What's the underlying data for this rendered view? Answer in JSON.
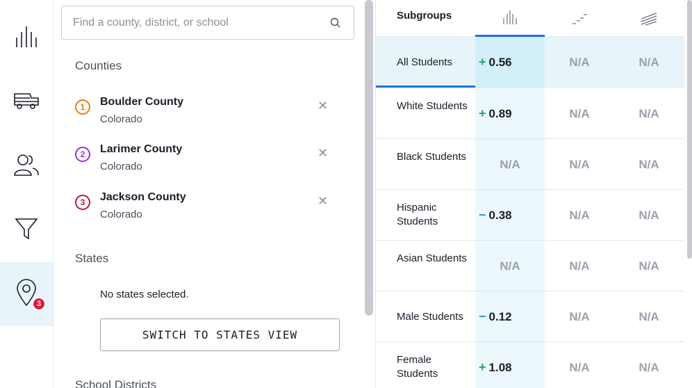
{
  "rail": {
    "items": [
      {
        "icon": "bar-chart-icon"
      },
      {
        "icon": "school-bus-icon"
      },
      {
        "icon": "people-icon"
      },
      {
        "icon": "filter-icon"
      },
      {
        "icon": "location-pin-icon",
        "badge": "3"
      }
    ]
  },
  "search": {
    "placeholder": "Find a county, district, or school"
  },
  "counties": {
    "title": "Counties",
    "items": [
      {
        "num": "1",
        "name": "Boulder County",
        "state": "Colorado",
        "color": "#f07a14"
      },
      {
        "num": "2",
        "name": "Larimer County",
        "state": "Colorado",
        "color": "#9b2ee6"
      },
      {
        "num": "3",
        "name": "Jackson County",
        "state": "Colorado",
        "color": "#c0163a"
      }
    ]
  },
  "states": {
    "title": "States",
    "empty": "No states selected.",
    "switch_label": "SWITCH TO STATES VIEW"
  },
  "districts": {
    "title": "School Districts"
  },
  "table": {
    "header": "Subgroups",
    "rows": [
      {
        "label": "All Students",
        "sign": "+",
        "value": "0.56",
        "c2": "N/A",
        "c3": "N/A"
      },
      {
        "label": "White Students",
        "sign": "+",
        "value": "0.89",
        "c2": "N/A",
        "c3": "N/A"
      },
      {
        "label": "Black Students",
        "sign": "",
        "value": "N/A",
        "c2": "N/A",
        "c3": "N/A"
      },
      {
        "label": "Hispanic Students",
        "sign": "−",
        "value": "0.38",
        "c2": "N/A",
        "c3": "N/A"
      },
      {
        "label": "Asian Students",
        "sign": "",
        "value": "N/A",
        "c2": "N/A",
        "c3": "N/A"
      },
      {
        "label": "Male Students",
        "sign": "−",
        "value": "0.12",
        "c2": "N/A",
        "c3": "N/A"
      },
      {
        "label": "Female Students",
        "sign": "+",
        "value": "1.08",
        "c2": "N/A",
        "c3": "N/A"
      }
    ]
  }
}
